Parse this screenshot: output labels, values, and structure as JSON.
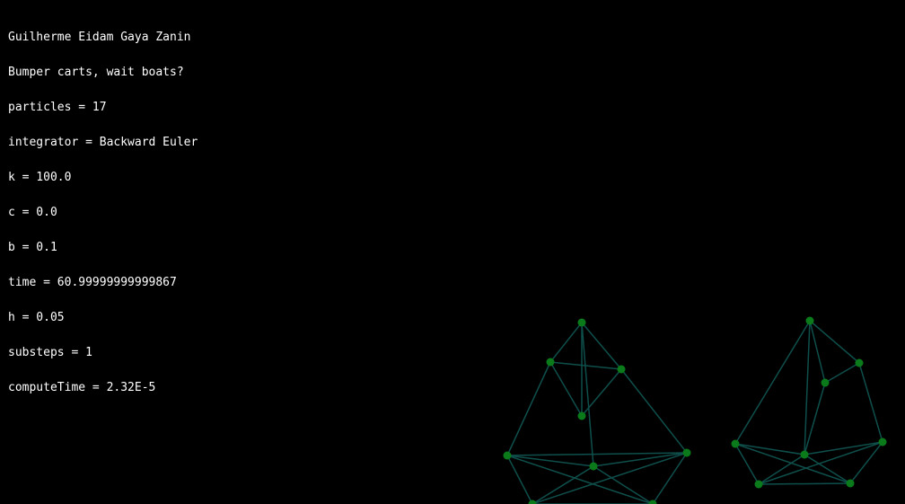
{
  "overlay": {
    "lines": [
      "Guilherme Eidam Gaya Zanin",
      "Bumper carts, wait boats?",
      "particles = 17",
      "integrator = Backward Euler",
      "k = 100.0",
      "c = 0.0",
      "b = 0.1",
      "time = 60.99999999999867",
      "h = 0.05",
      "substeps = 1",
      "computeTime = 2.32E-5"
    ]
  },
  "colors": {
    "background": "#000000",
    "text": "#ffffff",
    "spring": "#0f4f4b",
    "particle": "#0a7a1a"
  }
}
